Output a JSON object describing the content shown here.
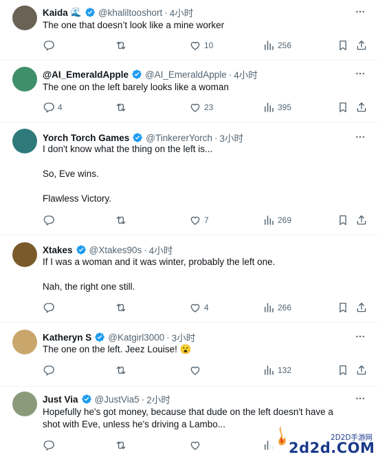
{
  "tweets": [
    {
      "name": "Kaida",
      "emoji": "🌊",
      "handle": "@khaliltooshort",
      "time": "4小时",
      "lines": [
        "The one that doesn’t look like a mine worker"
      ],
      "reply": "",
      "retweet": "",
      "like": "10",
      "views": "256",
      "avatar_color": "#6b6256"
    },
    {
      "name": "@AI_EmeraldApple",
      "handle": "@AI_EmeraldApple",
      "time": "4小时",
      "lines": [
        "The one on the left barely looks like a woman"
      ],
      "reply": "4",
      "retweet": "",
      "like": "23",
      "views": "395",
      "avatar_color": "#3f8f6a"
    },
    {
      "name": "Yorch Torch Games",
      "handle": "@TinkererYorch",
      "time": "3小时",
      "lines": [
        "I don't know what the thing on the left is...",
        "",
        "So, Eve wins.",
        "",
        "Flawless Victory."
      ],
      "reply": "",
      "retweet": "",
      "like": "7",
      "views": "269",
      "avatar_color": "#2e7a7a"
    },
    {
      "name": "Xtakes",
      "handle": "@Xtakes90s",
      "time": "4小时",
      "lines": [
        "If I was a woman and it was winter, probably the left one.",
        "",
        "Nah, the right one still."
      ],
      "reply": "",
      "retweet": "",
      "like": "4",
      "views": "266",
      "avatar_color": "#7a5a2a"
    },
    {
      "name": "Katheryn S",
      "handle": "@Katgirl3000",
      "time": "3小时",
      "lines": [
        "The one on the left.  Jeez Louise! 😮"
      ],
      "reply": "",
      "retweet": "",
      "like": "",
      "views": "132",
      "avatar_color": "#c9a66b"
    },
    {
      "name": "Just Via",
      "handle": "@JustVia5",
      "time": "2小时",
      "lines": [
        "Hopefully he's got money, because that dude on the left doesn't have a",
        "shot with Eve, unless he's driving a Lambo..."
      ],
      "reply": "",
      "retweet": "",
      "like": "",
      "views": "",
      "avatar_color": "#8a9a7a"
    }
  ],
  "watermark": {
    "site": "2D2D手游网",
    "logo": "2d2d.COM"
  },
  "colors": {
    "verified": "#1d9bf0",
    "muted": "#536471",
    "text": "#0f1419",
    "divider": "#eff3f4",
    "watermark": "#1a3a8a"
  }
}
